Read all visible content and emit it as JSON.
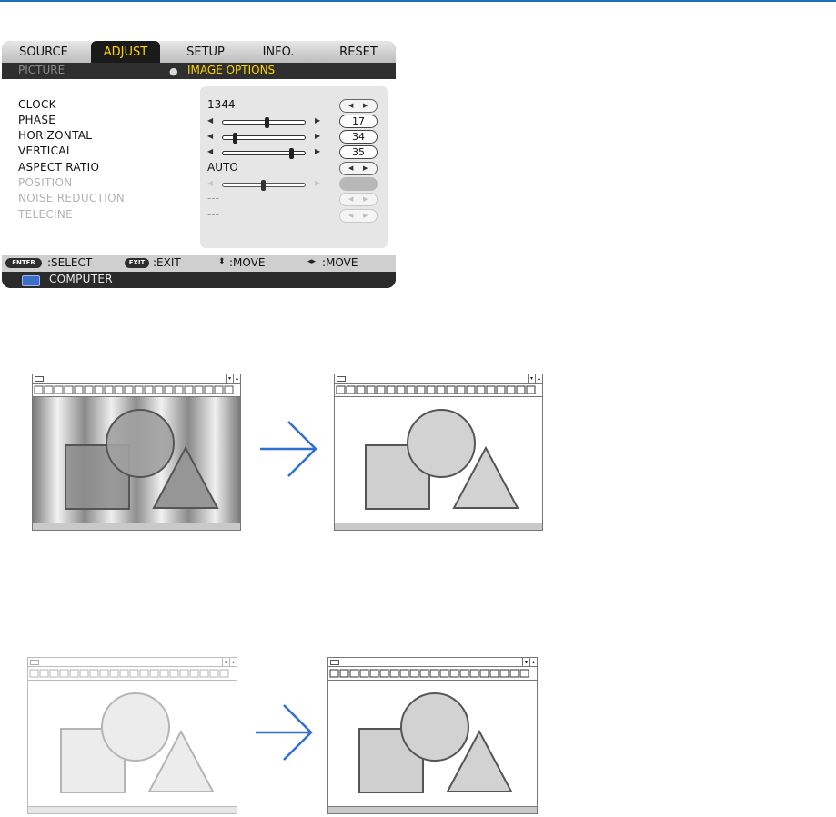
{
  "menu": {
    "tabs": [
      {
        "label": "SOURCE",
        "active": false
      },
      {
        "label": "ADJUST",
        "active": true
      },
      {
        "label": "SETUP",
        "active": false
      },
      {
        "label": "INFO.",
        "active": false
      },
      {
        "label": "RESET",
        "active": false
      }
    ],
    "sub_picture": "PICTURE",
    "sub_image_options": "IMAGE OPTIONS",
    "rows": [
      {
        "label": "CLOCK",
        "value": "1344",
        "control": "arrows",
        "enabled": true
      },
      {
        "label": "PHASE",
        "value": "17",
        "slider_fraction": 0.55,
        "enabled": true
      },
      {
        "label": "HORIZONTAL",
        "value": "34",
        "slider_fraction": 0.14,
        "enabled": true
      },
      {
        "label": "VERTICAL",
        "value": "35",
        "slider_fraction": 0.86,
        "enabled": true
      },
      {
        "label": "ASPECT RATIO",
        "value": "AUTO",
        "control": "arrows",
        "enabled": true
      },
      {
        "label": "POSITION",
        "value": "",
        "slider_fraction": 0.5,
        "enabled": false
      },
      {
        "label": "NOISE REDUCTION",
        "value": "---",
        "control": "arrows",
        "enabled": false
      },
      {
        "label": "TELECINE",
        "value": "---",
        "control": "arrows",
        "enabled": false
      }
    ],
    "footer": {
      "enter_key": "ENTER",
      "select": ":SELECT",
      "exit_key": "EXIT",
      "exit": ":EXIT",
      "move_updown": ":MOVE",
      "move_leftright": ":MOVE"
    },
    "source_label": "COMPUTER"
  },
  "colors": {
    "accent_yellow": "#ffd400",
    "arrow_blue": "#2f6fd0",
    "top_rule": "#1f6fc4"
  }
}
